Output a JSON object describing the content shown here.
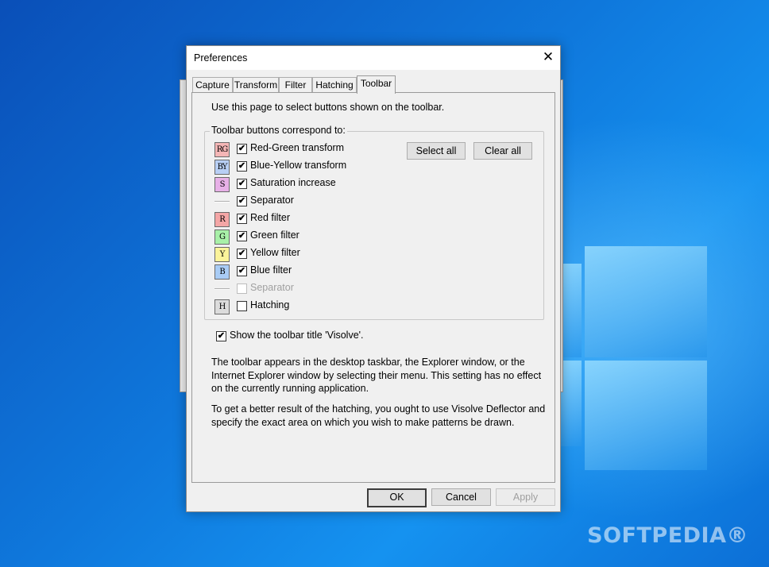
{
  "desktop": {
    "watermark": "SOFTPEDIA®"
  },
  "dialog": {
    "title": "Preferences",
    "close_glyph": "✕",
    "tabs": [
      {
        "label": "Capture"
      },
      {
        "label": "Transform"
      },
      {
        "label": "Filter"
      },
      {
        "label": "Hatching"
      },
      {
        "label": "Toolbar",
        "active": true
      }
    ],
    "intro": "Use this page to select buttons shown on the toolbar.",
    "group_label": "Toolbar buttons correspond to:",
    "items": [
      {
        "icon": "RG",
        "label": "Red-Green transform",
        "checked": true,
        "icon_color": "#f4b6b6"
      },
      {
        "icon": "BY",
        "label": "Blue-Yellow transform",
        "checked": true,
        "icon_color": "#b8cff5"
      },
      {
        "icon": "S",
        "label": "Saturation increase",
        "checked": true,
        "icon_color": "#e7b0e7"
      },
      {
        "icon": "",
        "label": "Separator",
        "checked": true
      },
      {
        "icon": "R",
        "label": "Red filter",
        "checked": true,
        "icon_color": "#f4a6a6"
      },
      {
        "icon": "G",
        "label": "Green filter",
        "checked": true,
        "icon_color": "#a8f0a8"
      },
      {
        "icon": "Y",
        "label": "Yellow filter",
        "checked": true,
        "icon_color": "#fbf39a"
      },
      {
        "icon": "B",
        "label": "Blue filter",
        "checked": true,
        "icon_color": "#a9ccf5"
      },
      {
        "icon": "",
        "label": "Separator",
        "checked": false,
        "disabled": true
      },
      {
        "icon": "H",
        "label": "Hatching",
        "checked": false,
        "icon_color": "#dcdcdc"
      }
    ],
    "select_all": "Select all",
    "clear_all": "Clear all",
    "show_title_label": "Show the toolbar title 'Visolve'.",
    "show_title_checked": true,
    "check_glyph": "✔",
    "paragraph1": "The toolbar appears in the desktop taskbar, the Explorer window, or the Internet Explorer window by selecting their menu.  This setting has no effect on the currently running application.",
    "paragraph2": "To get a better result of the hatching, you ought to use Visolve Deflector and specify the exact area on which you wish to make patterns be drawn.",
    "ok": "OK",
    "cancel": "Cancel",
    "apply": "Apply"
  }
}
